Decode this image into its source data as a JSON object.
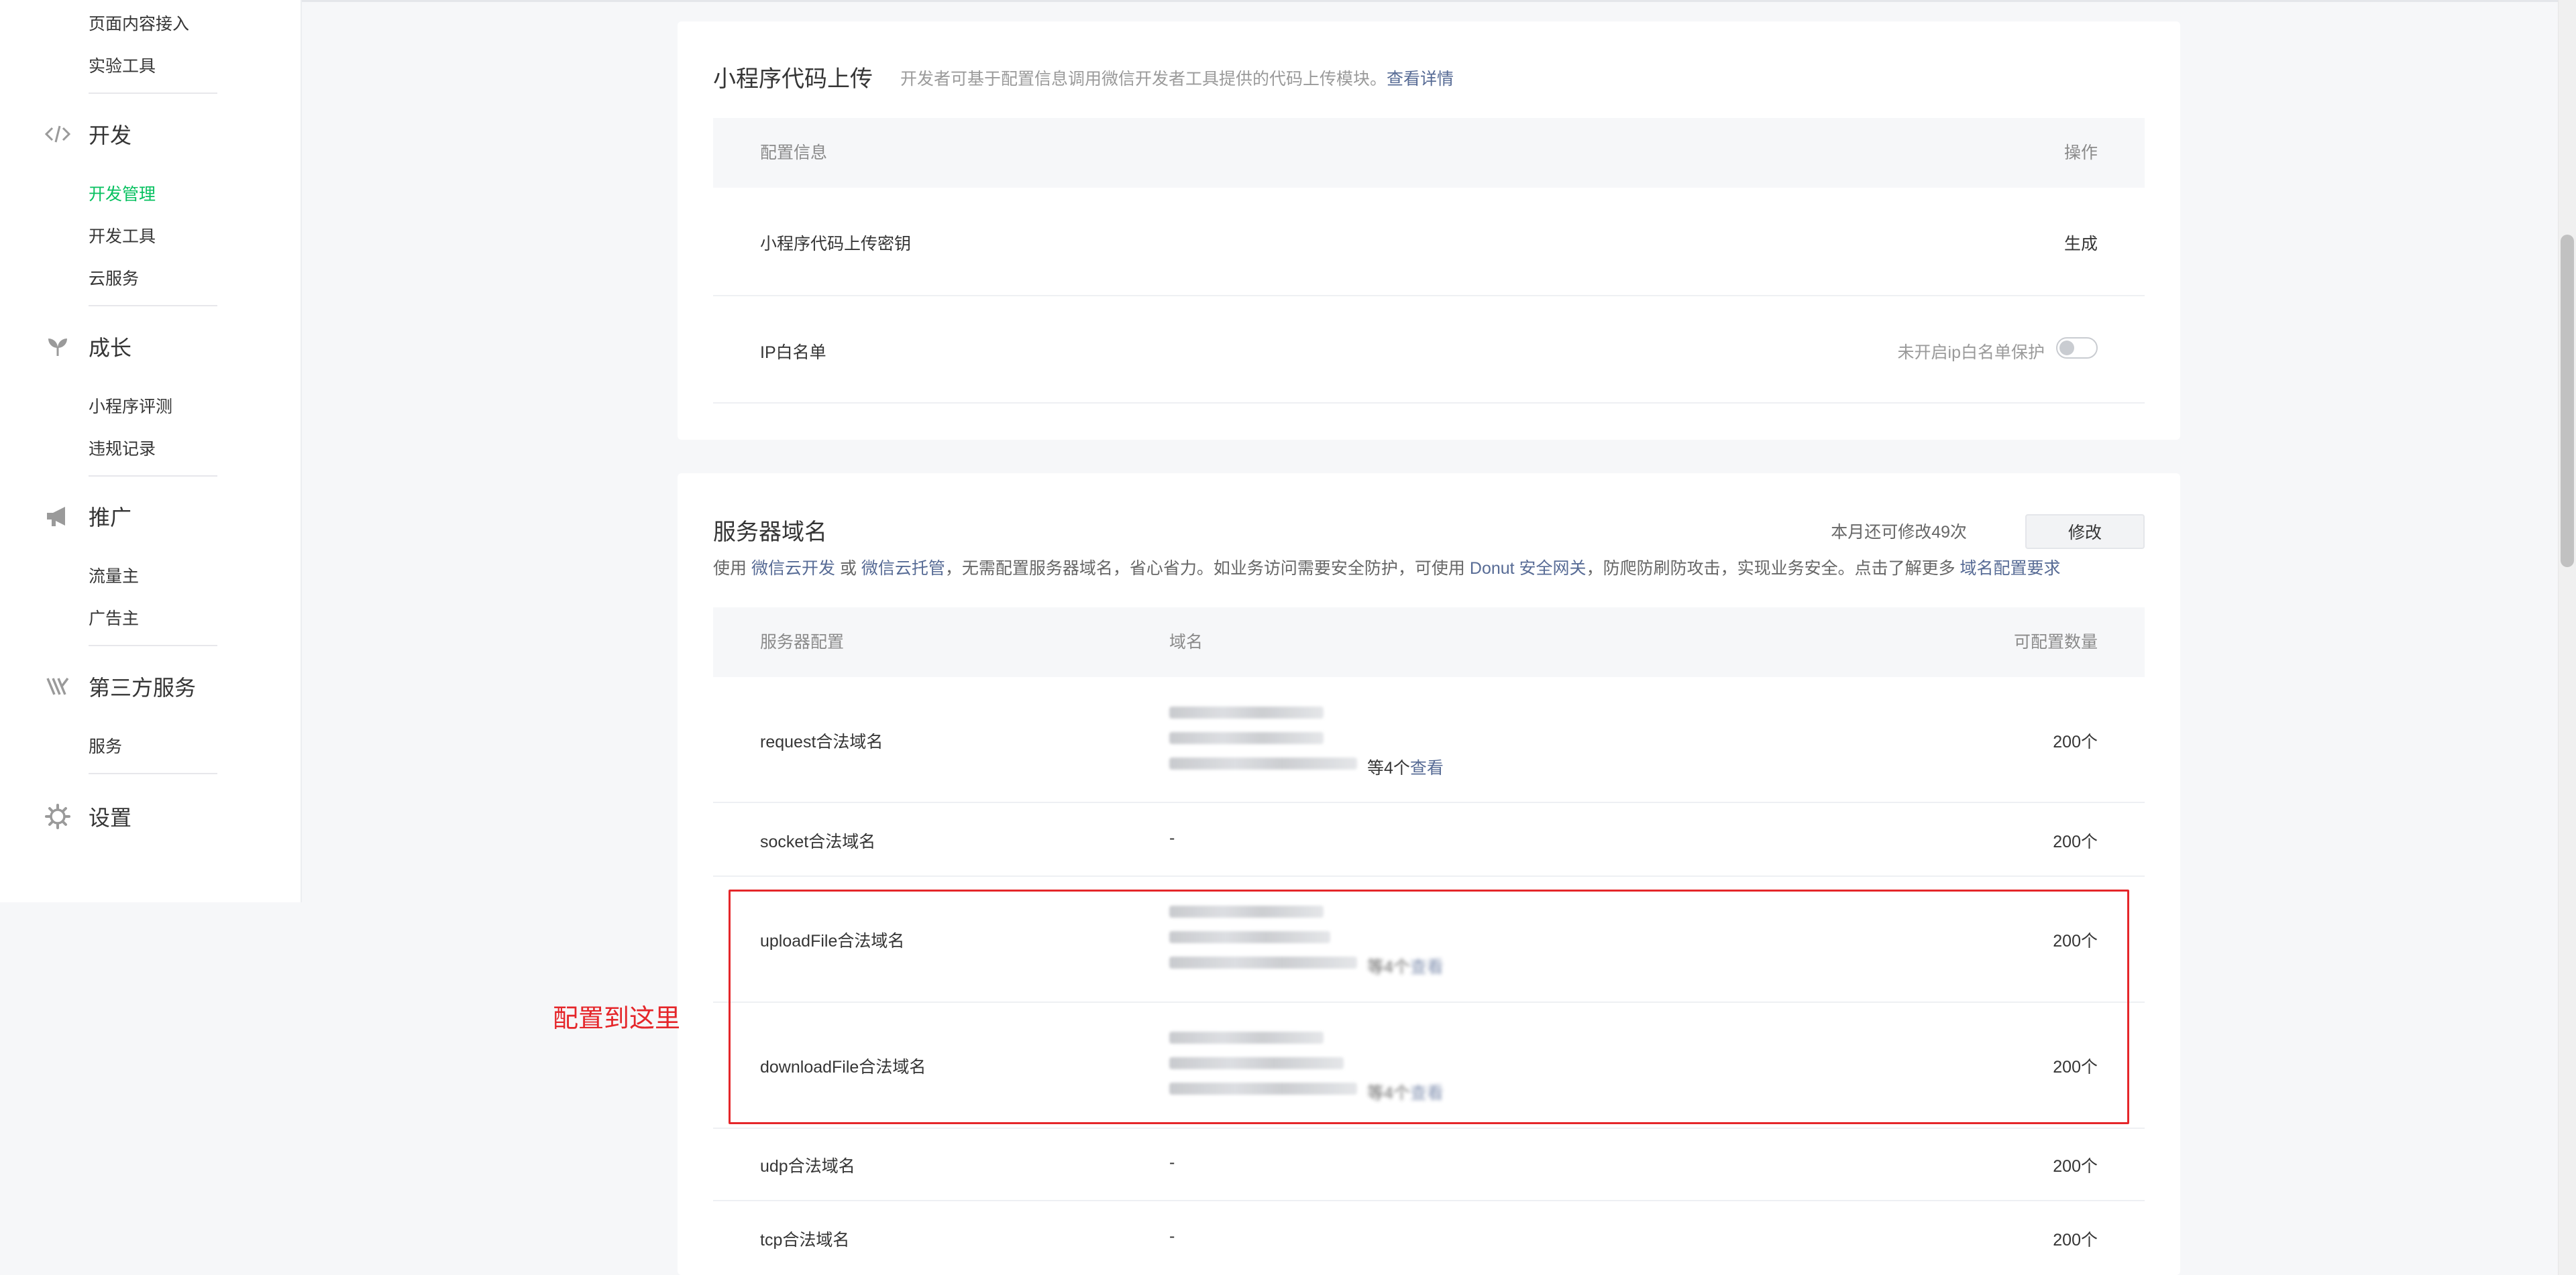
{
  "sidebar": {
    "sub_items_top": [
      "页面内容接入",
      "实验工具"
    ],
    "groups": [
      {
        "label": "开发",
        "icon": "code-icon",
        "items": [
          "开发管理",
          "开发工具",
          "云服务"
        ],
        "active_item": "开发管理"
      },
      {
        "label": "成长",
        "icon": "sprout-icon",
        "items": [
          "小程序评测",
          "违规记录"
        ]
      },
      {
        "label": "推广",
        "icon": "megaphone-icon",
        "items": [
          "流量主",
          "广告主"
        ]
      },
      {
        "label": "第三方服务",
        "icon": "third-party-icon",
        "items": [
          "服务"
        ]
      },
      {
        "label": "设置",
        "icon": "gear-icon",
        "items": []
      }
    ]
  },
  "upload_card": {
    "title": "小程序代码上传",
    "desc": "开发者可基于配置信息调用微信开发者工具提供的代码上传模块。",
    "desc_link": "查看详情",
    "header": {
      "col1": "配置信息",
      "col2": "操作"
    },
    "rows": [
      {
        "label": "小程序代码上传密钥",
        "action": "生成"
      },
      {
        "label": "IP白名单",
        "status": "未开启ip白名单保护"
      }
    ]
  },
  "domain_card": {
    "title": "服务器域名",
    "quota_text": "本月还可修改49次",
    "edit_button": "修改",
    "desc": {
      "p1": "使用",
      "link1": "微信云开发",
      "p2": "或",
      "link2": "微信云托管",
      "p3": "，无需配置服务器域名，省心省力。如业务访问需要安全防护，可使用",
      "link3": "Donut 安全网关",
      "p4": "，防爬防刷防攻击，实现业务安全。点击了解更多",
      "link4": "域名配置要求"
    },
    "header": {
      "col1": "服务器配置",
      "col2": "域名",
      "col3": "可配置数量"
    },
    "more_prefix": "等4个",
    "more_link": "查看",
    "rows": [
      {
        "name": "request合法域名",
        "domain": "",
        "count": "200个"
      },
      {
        "name": "socket合法域名",
        "domain": "-",
        "count": "200个"
      },
      {
        "name": "uploadFile合法域名",
        "domain": "",
        "count": "200个"
      },
      {
        "name": "downloadFile合法域名",
        "domain": "",
        "count": "200个"
      },
      {
        "name": "udp合法域名",
        "domain": "-",
        "count": "200个"
      },
      {
        "name": "tcp合法域名",
        "domain": "-",
        "count": "200个"
      }
    ]
  },
  "annotation": {
    "text": "配置到这里",
    "color": "#e5262a"
  },
  "colors": {
    "active": "#07c160",
    "link": "#576b95",
    "highlight": "#e5262a"
  }
}
